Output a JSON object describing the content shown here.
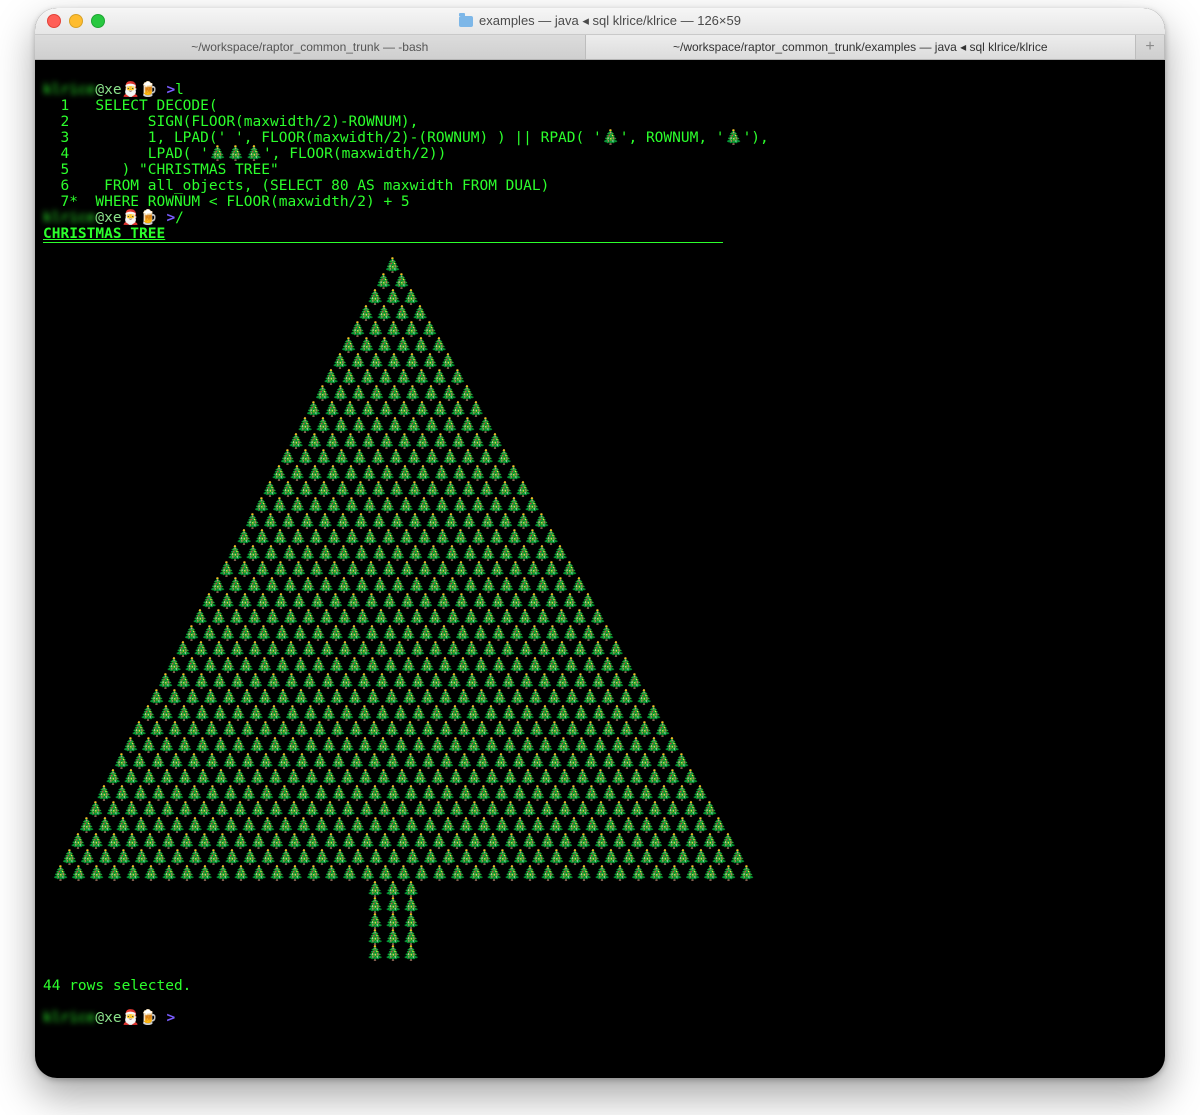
{
  "window": {
    "title": "examples — java ◂ sql klrice/klrice — 126×59"
  },
  "tabs": [
    {
      "label": "~/workspace/raptor_common_trunk — -bash",
      "active": false
    },
    {
      "label": "~/workspace/raptor_common_trunk/examples — java ◂ sql klrice/klrice",
      "active": true
    }
  ],
  "prompt": {
    "user": "klrice",
    "host": "xe",
    "emoji": "🎅🍺",
    "caret": ">"
  },
  "commands": [
    "l",
    "/"
  ],
  "sql": {
    "lines": [
      " SELECT DECODE(",
      "       SIGN(FLOOR(maxwidth/2)-ROWNUM),",
      "       1, LPAD(' ', FLOOR(maxwidth/2)-(ROWNUM) ) || RPAD( '🎄', ROWNUM, '🎄'),",
      "       LPAD( '🎄🎄🎄', FLOOR(maxwidth/2))",
      "    ) \"CHRISTMAS TREE\"",
      "  FROM all_objects, (SELECT 80 AS maxwidth FROM DUAL)",
      " WHERE ROWNUM < FLOOR(maxwidth/2) + 5"
    ]
  },
  "result": {
    "header": "CHRISTMAS TREE",
    "maxwidth": 80,
    "tree_glyph": "🎄",
    "row_count": 44,
    "status": "44 rows selected."
  }
}
